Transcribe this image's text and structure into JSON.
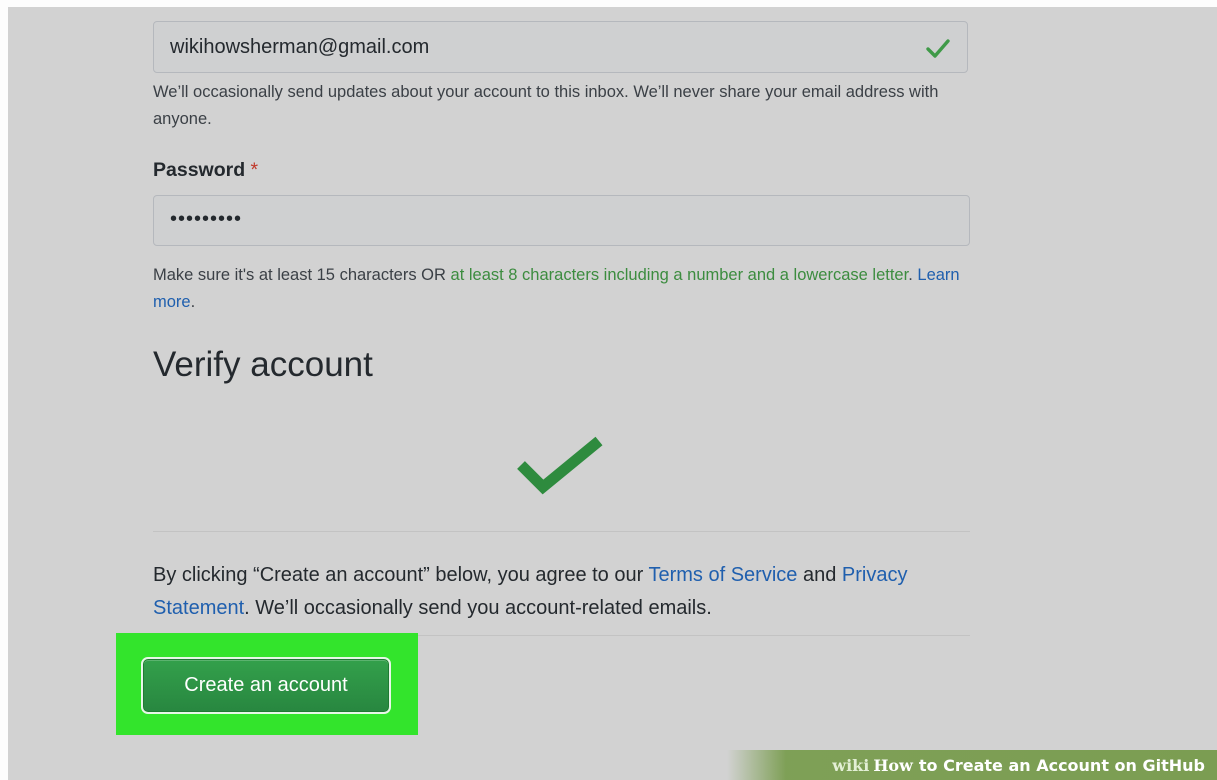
{
  "email": {
    "value": "wikihowsherman@gmail.com",
    "valid_icon": "check-icon",
    "help_text": "We’ll occasionally send updates about your account to this inbox. We’ll never share your email address with anyone."
  },
  "password": {
    "label": "Password",
    "required_marker": "*",
    "value": "•••••••••",
    "help_prefix": "Make sure it's at least 15 characters OR ",
    "help_highlight": "at least 8 characters including a number and a lowercase letter",
    "help_suffix": ".",
    "learn_more": "Learn more",
    "learn_more_suffix": "."
  },
  "verify": {
    "heading": "Verify account",
    "icon": "check-icon"
  },
  "agreement": {
    "prefix": "By clicking “Create an account” below, you agree to our ",
    "terms_link": "Terms of Service",
    "and": " and ",
    "privacy_link": "Privacy Statement",
    "suffix": ". We’ll occasionally send you account-related emails."
  },
  "create_button": {
    "label": "Create an account"
  },
  "watermark": {
    "brand_wiki": "wiki",
    "brand_how": "How",
    "title": "to Create an Account on GitHub"
  },
  "colors": {
    "highlight": "#33e42c",
    "button": "#2c8a43",
    "check": "#2e8b3e",
    "link": "#1f5fae",
    "help_highlight": "#3c8c3f"
  }
}
